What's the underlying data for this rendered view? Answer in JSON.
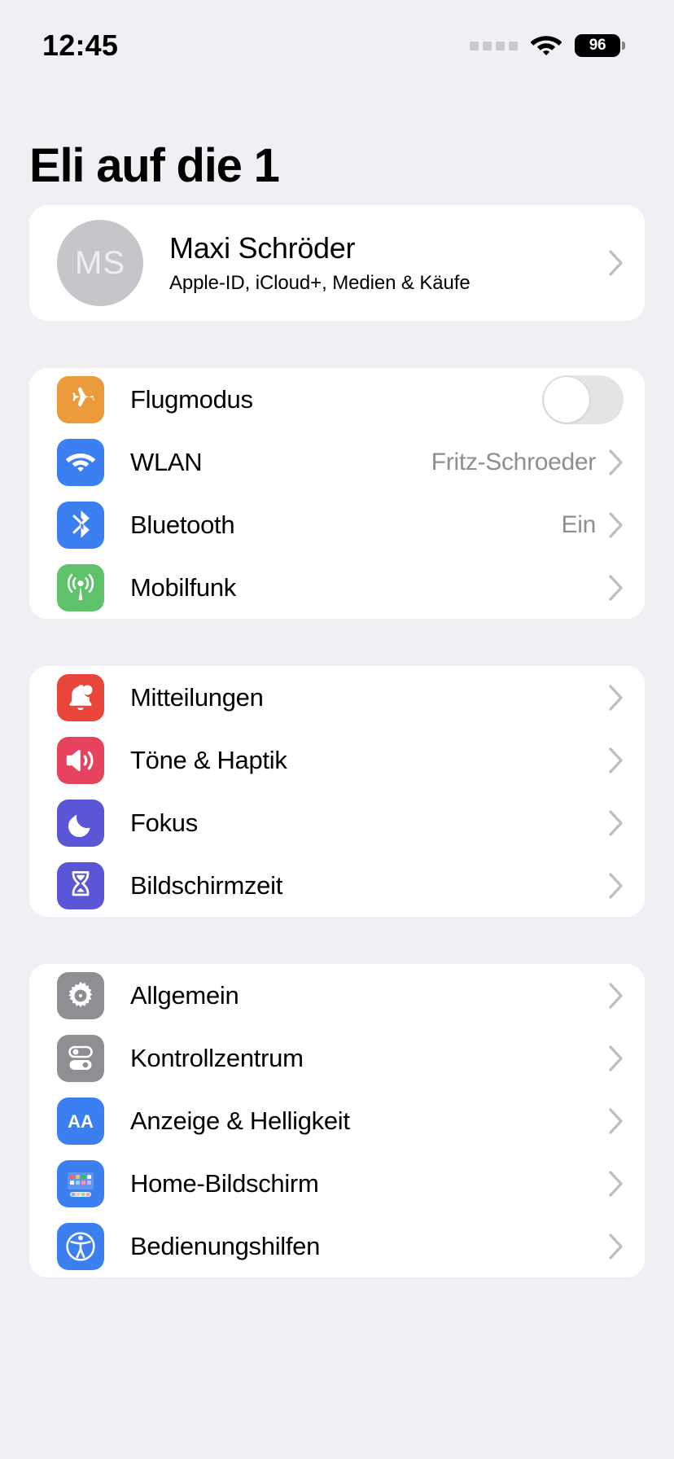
{
  "statusbar": {
    "time": "12:45",
    "signal_icon": "signal-dots-icon",
    "wifi_icon": "wifi-icon",
    "battery_level": "96",
    "battery_icon": "battery-icon"
  },
  "header": {
    "title": "Eli auf die 1"
  },
  "profile": {
    "initials": "MS",
    "name": "Maxi Schröder",
    "subtitle": "Apple-ID, iCloud+, Medien & Käufe",
    "chevron": "chevron-right-icon"
  },
  "groups": [
    {
      "id": "connectivity",
      "rows": [
        {
          "label": "Flugmodus",
          "icon": "airplane-icon",
          "icon_color": "#eb9a3c",
          "control": "toggle",
          "toggle_on": false,
          "value": ""
        },
        {
          "label": "WLAN",
          "icon": "wifi-icon",
          "icon_color": "#3b7ff0",
          "control": "chevron",
          "value": "Fritz-Schroeder"
        },
        {
          "label": "Bluetooth",
          "icon": "bluetooth-icon",
          "icon_color": "#3b7ff0",
          "control": "chevron",
          "value": "Ein"
        },
        {
          "label": "Mobilfunk",
          "icon": "cellular-antenna-icon",
          "icon_color": "#5dc26a",
          "control": "chevron",
          "value": ""
        }
      ]
    },
    {
      "id": "notifications",
      "rows": [
        {
          "label": "Mitteilungen",
          "icon": "bell-icon",
          "icon_color": "#e9453a",
          "control": "chevron",
          "value": ""
        },
        {
          "label": "Töne & Haptik",
          "icon": "speaker-wave-icon",
          "icon_color": "#e8435e",
          "control": "chevron",
          "value": ""
        },
        {
          "label": "Fokus",
          "icon": "moon-icon",
          "icon_color": "#5a56d6",
          "control": "chevron",
          "value": ""
        },
        {
          "label": "Bildschirmzeit",
          "icon": "hourglass-icon",
          "icon_color": "#5a56d6",
          "control": "chevron",
          "value": ""
        }
      ]
    },
    {
      "id": "system",
      "rows": [
        {
          "label": "Allgemein",
          "icon": "gear-icon",
          "icon_color": "#8e8e93",
          "control": "chevron",
          "value": ""
        },
        {
          "label": "Kontrollzentrum",
          "icon": "control-center-icon",
          "icon_color": "#8e8e93",
          "control": "chevron",
          "value": ""
        },
        {
          "label": "Anzeige & Helligkeit",
          "icon": "display-aa-icon",
          "icon_color": "#3b7ff0",
          "control": "chevron",
          "value": ""
        },
        {
          "label": "Home-Bildschirm",
          "icon": "home-screen-grid-icon",
          "icon_color": "#3b7ff0",
          "control": "chevron",
          "value": ""
        },
        {
          "label": "Bedienungshilfen",
          "icon": "accessibility-icon",
          "icon_color": "#3b7ff0",
          "control": "chevron",
          "value": ""
        }
      ]
    }
  ],
  "colors": {
    "page_bg": "#f0eff4",
    "card_bg": "#ffffff",
    "secondary_text": "#8e8e93",
    "toggle_off_track": "#e4e4e6"
  }
}
